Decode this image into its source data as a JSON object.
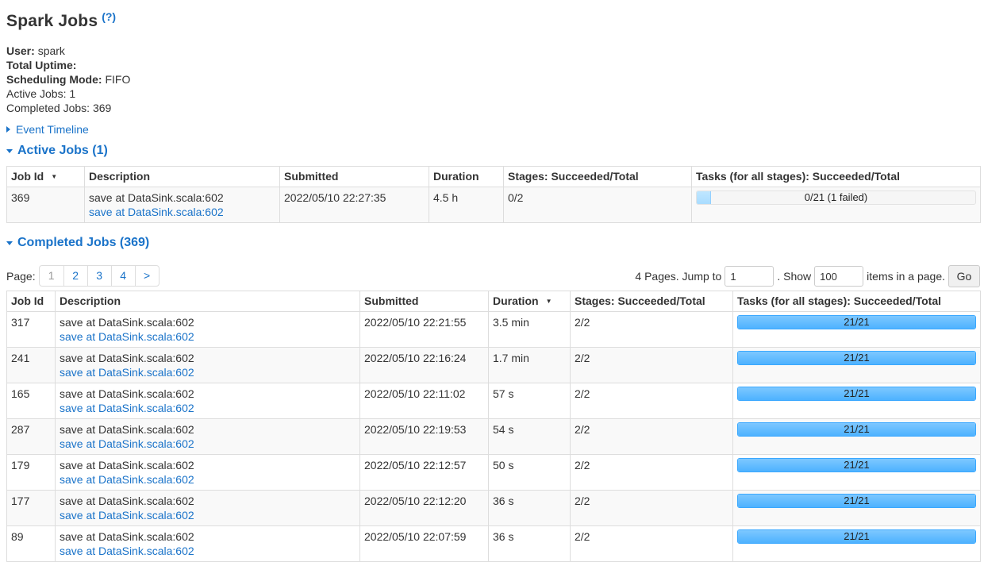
{
  "header": {
    "title": "Spark Jobs",
    "help": "(?)"
  },
  "summary": {
    "user_label": "User:",
    "user_value": "spark",
    "uptime_label": "Total Uptime:",
    "mode_label": "Scheduling Mode:",
    "mode_value": "FIFO",
    "active_label": "Active Jobs:",
    "active_value": "1",
    "completed_label": "Completed Jobs:",
    "completed_value": "369"
  },
  "timeline": {
    "label": "Event Timeline"
  },
  "active": {
    "heading": "Active Jobs (1)",
    "columns": [
      "Job Id",
      "Description",
      "Submitted",
      "Duration",
      "Stages: Succeeded/Total",
      "Tasks (for all stages): Succeeded/Total"
    ],
    "rows": [
      {
        "id": "369",
        "desc": "save at DataSink.scala:602",
        "desc_link": "save at DataSink.scala:602",
        "submitted": "2022/05/10 22:27:35",
        "duration": "4.5 h",
        "stages": "0/2",
        "tasks": "0/21 (1 failed)",
        "progress": 0.05
      }
    ]
  },
  "completed": {
    "heading": "Completed Jobs (369)",
    "pager": {
      "label": "Page:",
      "pages": [
        "1",
        "2",
        "3",
        "4",
        ">"
      ],
      "pages_text": "4 Pages. Jump to",
      "jump_value": "1",
      "show_text": ". Show",
      "show_value": "100",
      "items_text": "items in a page.",
      "go_label": "Go"
    },
    "columns": [
      "Job Id",
      "Description",
      "Submitted",
      "Duration",
      "Stages: Succeeded/Total",
      "Tasks (for all stages): Succeeded/Total"
    ],
    "rows": [
      {
        "id": "317",
        "desc": "save at DataSink.scala:602",
        "desc_link": "save at DataSink.scala:602",
        "submitted": "2022/05/10 22:21:55",
        "duration": "3.5 min",
        "stages": "2/2",
        "tasks": "21/21",
        "progress": 1
      },
      {
        "id": "241",
        "desc": "save at DataSink.scala:602",
        "desc_link": "save at DataSink.scala:602",
        "submitted": "2022/05/10 22:16:24",
        "duration": "1.7 min",
        "stages": "2/2",
        "tasks": "21/21",
        "progress": 1
      },
      {
        "id": "165",
        "desc": "save at DataSink.scala:602",
        "desc_link": "save at DataSink.scala:602",
        "submitted": "2022/05/10 22:11:02",
        "duration": "57 s",
        "stages": "2/2",
        "tasks": "21/21",
        "progress": 1
      },
      {
        "id": "287",
        "desc": "save at DataSink.scala:602",
        "desc_link": "save at DataSink.scala:602",
        "submitted": "2022/05/10 22:19:53",
        "duration": "54 s",
        "stages": "2/2",
        "tasks": "21/21",
        "progress": 1
      },
      {
        "id": "179",
        "desc": "save at DataSink.scala:602",
        "desc_link": "save at DataSink.scala:602",
        "submitted": "2022/05/10 22:12:57",
        "duration": "50 s",
        "stages": "2/2",
        "tasks": "21/21",
        "progress": 1
      },
      {
        "id": "177",
        "desc": "save at DataSink.scala:602",
        "desc_link": "save at DataSink.scala:602",
        "submitted": "2022/05/10 22:12:20",
        "duration": "36 s",
        "stages": "2/2",
        "tasks": "21/21",
        "progress": 1
      },
      {
        "id": "89",
        "desc": "save at DataSink.scala:602",
        "desc_link": "save at DataSink.scala:602",
        "submitted": "2022/05/10 22:07:59",
        "duration": "36 s",
        "stages": "2/2",
        "tasks": "21/21",
        "progress": 1
      }
    ]
  },
  "colors": {
    "link": "#1a73c9",
    "bar": "#4db2ff",
    "border": "#dddddd"
  }
}
